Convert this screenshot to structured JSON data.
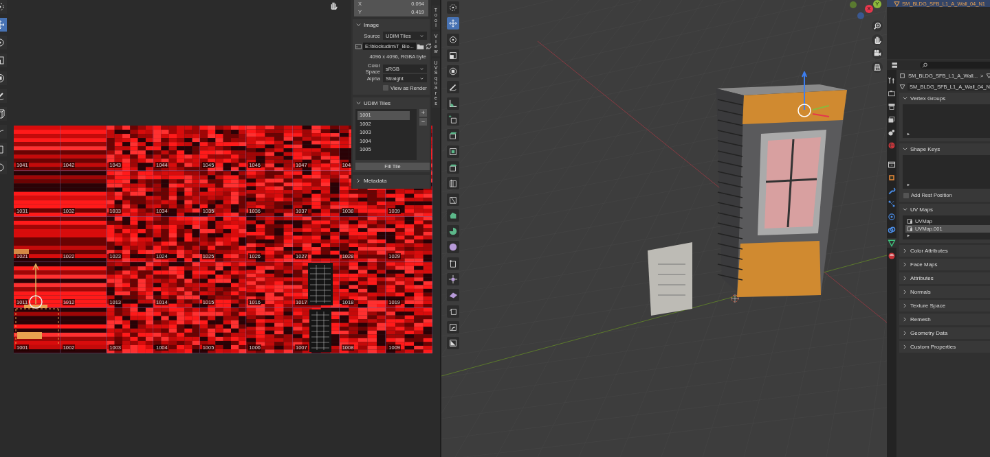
{
  "uv_editor": {
    "tools": [
      {
        "kind": "cursor",
        "selected": false
      },
      {
        "kind": "move",
        "selected": true
      },
      {
        "kind": "rotate",
        "selected": false
      },
      {
        "kind": "scale",
        "selected": false
      },
      {
        "kind": "transform",
        "selected": false
      },
      {
        "kind": "annotate",
        "selected": false
      },
      {
        "kind": "cube",
        "selected": false
      },
      {
        "kind": "grab",
        "selected": false
      },
      {
        "kind": "relax",
        "selected": false
      },
      {
        "kind": "pinch",
        "selected": false
      }
    ],
    "tiles": [
      [
        "1041",
        "1042",
        "1043",
        "1044",
        "1045",
        "1046",
        "1047",
        "104"
      ],
      [
        "1031",
        "1032",
        "1033",
        "1034",
        "1035",
        "1036",
        "1037",
        "1038",
        "1039"
      ],
      [
        "1021",
        "1022",
        "1023",
        "1024",
        "1025",
        "1026",
        "1027",
        "1028",
        "1029"
      ],
      [
        "1011",
        "1012",
        "1013",
        "1014",
        "1015",
        "1016",
        "1017",
        "1018",
        "1019"
      ],
      [
        "1001",
        "1002",
        "1003",
        "1004",
        "1005",
        "1006",
        "1007",
        "1008",
        "1009"
      ]
    ],
    "sidebar": {
      "fields": [
        {
          "label": "X",
          "value": "0.094"
        },
        {
          "label": "Y",
          "value": "0.419"
        }
      ],
      "image": {
        "title": "Image",
        "expanded": true,
        "source_label": "Source",
        "source": "UDIM Tiles",
        "path": "E:\\blockudim\\T_Blo...",
        "info": "4096 x 4096,  RGBA byte",
        "color_space_label": "Color Space",
        "color_space": "sRGB",
        "alpha_label": "Alpha",
        "alpha": "Straight",
        "view_as_render": {
          "label": "View as Render",
          "checked": false
        }
      },
      "udim": {
        "title": "UDIM Tiles",
        "expanded": true,
        "tiles": [
          {
            "label": "1001",
            "selected": true
          },
          {
            "label": "1002",
            "selected": false
          },
          {
            "label": "1003",
            "selected": false
          },
          {
            "label": "1004",
            "selected": false
          },
          {
            "label": "1005",
            "selected": false
          }
        ],
        "add": "+",
        "remove": "−",
        "fill": "Fill Tile"
      },
      "metadata": {
        "title": "Metadata",
        "expanded": false
      },
      "tabs": [
        {
          "label": "Tool"
        },
        {
          "label": "View"
        },
        {
          "label": "UV Squares"
        }
      ]
    }
  },
  "viewport": {
    "tools": [
      {
        "kind": "cursor",
        "selected": false
      },
      {
        "kind": "move",
        "selected": true
      },
      {
        "kind": "rotate",
        "selected": false
      },
      {
        "kind": "scale",
        "selected": false
      },
      {
        "kind": "transform",
        "selected": false
      },
      {
        "kind": "annotate",
        "selected": false
      },
      {
        "kind": "measure",
        "selected": false
      },
      {
        "kind": "add-cube",
        "selected": false
      },
      {
        "kind": "extrude",
        "selected": false
      },
      {
        "kind": "inset",
        "selected": false
      },
      {
        "kind": "bevel",
        "selected": false
      },
      {
        "kind": "loop-cut",
        "selected": false
      },
      {
        "kind": "knife",
        "selected": false
      },
      {
        "kind": "poly-build",
        "selected": false
      },
      {
        "kind": "spin",
        "selected": false
      },
      {
        "kind": "smooth",
        "selected": false
      },
      {
        "kind": "edge-slide",
        "selected": false
      },
      {
        "kind": "shrink",
        "selected": false
      },
      {
        "kind": "shear",
        "selected": false
      },
      {
        "kind": "rip",
        "selected": false
      },
      {
        "kind": "shade",
        "selected": false
      },
      {
        "kind": "mask",
        "selected": false
      }
    ],
    "gizmo": [
      {
        "label": "Y",
        "color": "#8cb83c"
      },
      {
        "label": "X",
        "color": "#e5374c"
      }
    ],
    "nav": [
      {
        "kind": "zoom"
      },
      {
        "kind": "pan"
      },
      {
        "kind": "camera"
      },
      {
        "kind": "grid"
      }
    ]
  },
  "properties": {
    "outliner_item": "SM_BLDG_SFB_L1_A_Wall_04_N1",
    "tabs": [
      {
        "kind": "tool",
        "selected": false
      },
      {
        "kind": "render",
        "selected": false
      },
      {
        "kind": "output",
        "selected": false
      },
      {
        "kind": "view-layer",
        "selected": false
      },
      {
        "kind": "scene",
        "selected": false
      },
      {
        "kind": "world",
        "selected": false
      },
      {
        "kind": "collection",
        "selected": false
      },
      {
        "kind": "object",
        "selected": false
      },
      {
        "kind": "modifier",
        "selected": false
      },
      {
        "kind": "particles",
        "selected": false
      },
      {
        "kind": "physics",
        "selected": false
      },
      {
        "kind": "constraints",
        "selected": false
      },
      {
        "kind": "data",
        "selected": true
      },
      {
        "kind": "material",
        "selected": false
      }
    ],
    "breadcrumb": "SM_BLDG_SFB_L1_A_Wall...",
    "breadcrumb_sep": ">",
    "mesh_name": "SM_BLDG_SFB_L1_A_Wall_04_N",
    "panels": [
      {
        "title": "Vertex Groups",
        "expanded": true,
        "kind": "empty-list"
      },
      {
        "title": "Shape Keys",
        "expanded": true,
        "kind": "empty-list",
        "checkbox": {
          "label": "Add Rest Position",
          "checked": false
        }
      },
      {
        "title": "UV Maps",
        "expanded": true,
        "kind": "list",
        "items": [
          {
            "label": "UVMap",
            "selected": false
          },
          {
            "label": "UVMap.001",
            "selected": true
          }
        ]
      },
      {
        "title": "Color Attributes",
        "expanded": false
      },
      {
        "title": "Face Maps",
        "expanded": false
      },
      {
        "title": "Attributes",
        "expanded": false
      },
      {
        "title": "Normals",
        "expanded": false
      },
      {
        "title": "Texture Space",
        "expanded": false
      },
      {
        "title": "Remesh",
        "expanded": false
      },
      {
        "title": "Geometry Data",
        "expanded": false
      },
      {
        "title": "Custom Properties",
        "expanded": false
      }
    ]
  }
}
